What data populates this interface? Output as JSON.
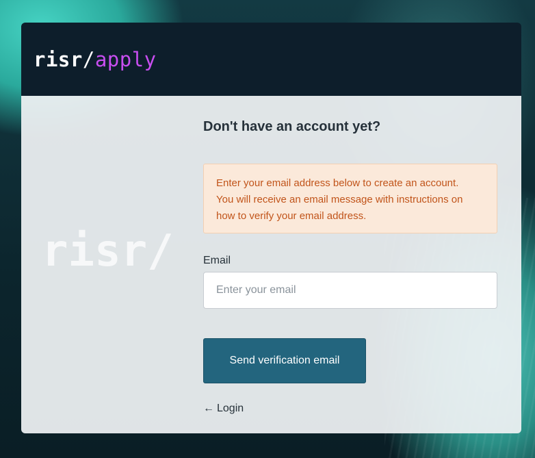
{
  "header": {
    "logo_brand": "risr",
    "logo_slash": "/",
    "logo_app": "apply"
  },
  "watermark": "risr/",
  "form": {
    "heading": "Don't have an account yet?",
    "alert_lines": [
      "Enter your email address below to create an account.",
      "You will receive an email message with instructions on",
      "how to verify your email address."
    ],
    "email_label": "Email",
    "email_placeholder": "Enter your email",
    "email_value": "",
    "submit_label": "Send verification email",
    "login_arrow": "←",
    "login_label": "Login"
  },
  "colors": {
    "header_bg": "#0d1e2b",
    "brand_accent": "#c84ef0",
    "button_bg": "#23657e",
    "alert_bg": "#fbe9da",
    "alert_text": "#c1541a"
  }
}
